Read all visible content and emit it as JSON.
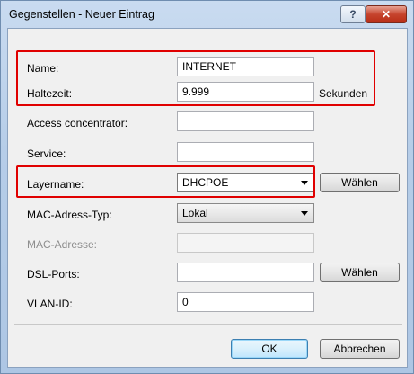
{
  "window": {
    "title": "Gegenstellen - Neuer Eintrag",
    "help_label": "?",
    "close_label": "✕"
  },
  "form": {
    "name": {
      "label": "Name:",
      "value": "INTERNET"
    },
    "haltezeit": {
      "label": "Haltezeit:",
      "value": "9.999",
      "unit": "Sekunden"
    },
    "access_concentrator": {
      "label": "Access concentrator:",
      "value": ""
    },
    "service": {
      "label": "Service:",
      "value": ""
    },
    "layername": {
      "label": "Layername:",
      "value": "DHCPOE",
      "button": "Wählen"
    },
    "mac_type": {
      "label": "MAC-Adress-Typ:",
      "value": "Lokal"
    },
    "mac_address": {
      "label": "MAC-Adresse:",
      "value": ""
    },
    "dsl_ports": {
      "label": "DSL-Ports:",
      "value": "",
      "button": "Wählen"
    },
    "vlan_id": {
      "label": "VLAN-ID:",
      "value": "0"
    }
  },
  "buttons": {
    "ok": "OK",
    "cancel": "Abbrechen"
  },
  "colors": {
    "highlight": "#e00000",
    "title_gradient": "#b6cde8",
    "close_button": "#c6442d"
  }
}
